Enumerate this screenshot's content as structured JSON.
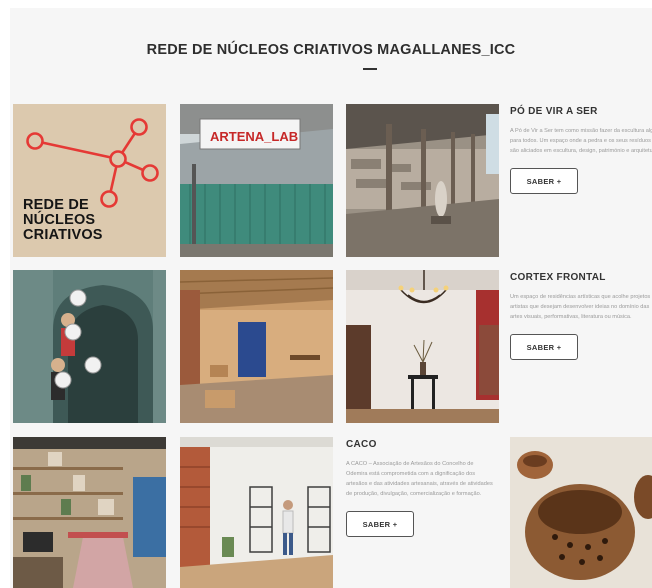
{
  "header": {
    "title": "REDE DE NÚCLEOS CRIATIVOS MAGALLANES_ICC"
  },
  "logo": {
    "lines": [
      "REDE DE",
      "NÚCLEOS",
      "CRIATIVOS"
    ]
  },
  "photos": {
    "artena_sign": "ARTENA_LAB"
  },
  "items": [
    {
      "title": "PÓ DE VIR A SER",
      "description": "A Pó de Vir a Ser tem como missão fazer da escultura algo para todos. Um espaço onde a pedra e os seus resíduos são aliciados em escultura, design, património e arquitetura.",
      "button": "SABER +"
    },
    {
      "title": "CORTEX FRONTAL",
      "description": "Um espaço de residências artísticas que acolhe projetos de artistas que desejam desenvolver ideias no domínio das artes visuais, performativas, literatura ou música.",
      "button": "SABER +"
    },
    {
      "title": "CACO",
      "description": "A CACO – Associação de Artesãos do Concelho de Odemira está comprometida com a dignificação dos artesãos e das atividades artesanais, através de atividades de produção, divulgação, comercialização e formação.",
      "button": "SABER +"
    }
  ],
  "colors": {
    "accent_red": "#e53935",
    "logo_bg": "#dcc9ae",
    "background": "#f6f6f6"
  }
}
